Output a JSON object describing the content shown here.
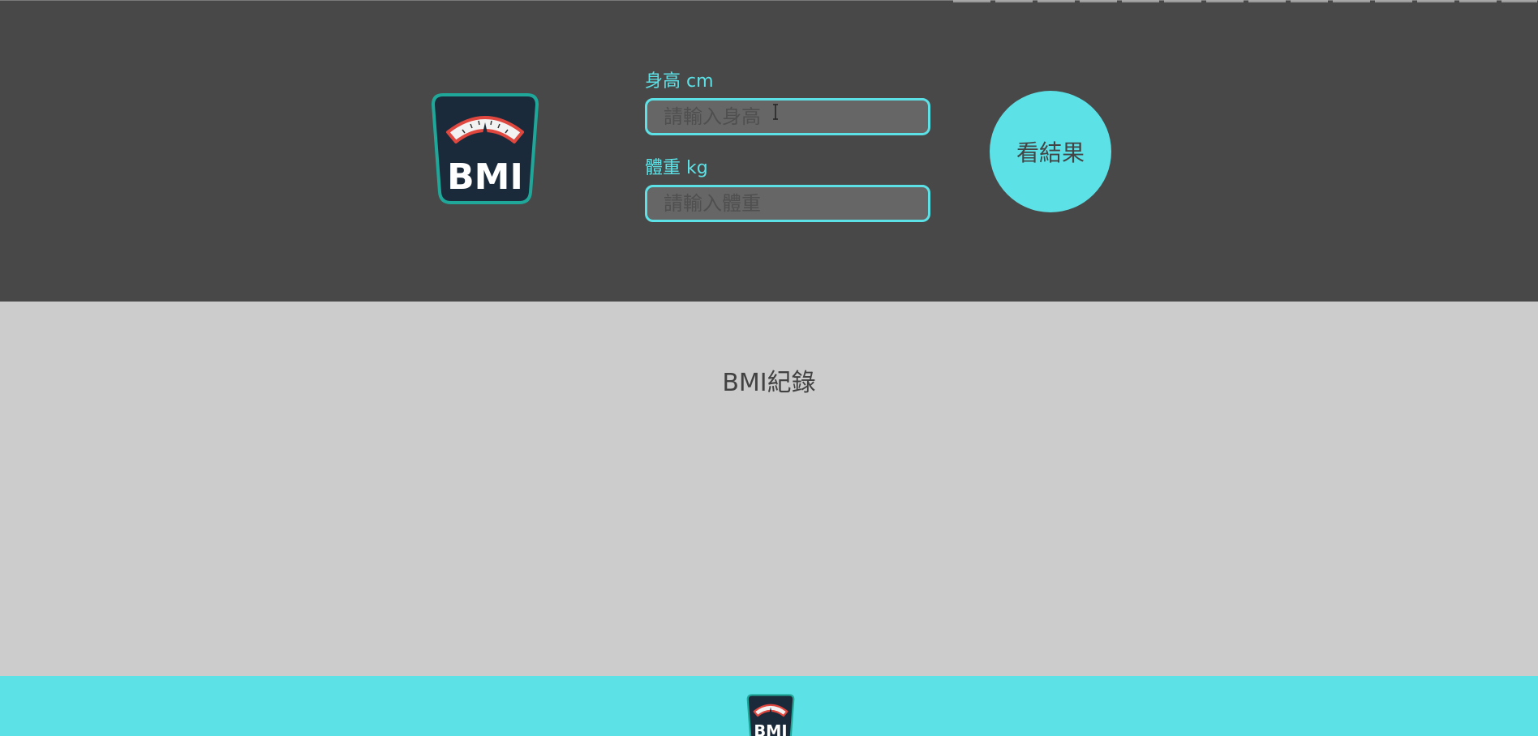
{
  "header": {
    "logo_icon": "bmi-scale-logo-icon",
    "logo_text": "BMI",
    "height_label": "身高 cm",
    "height_placeholder": "請輸入身高",
    "weight_label": "體重 kg",
    "weight_placeholder": "請輸入體重",
    "result_button_label": "看結果"
  },
  "records": {
    "title": "BMI紀錄"
  },
  "footer": {
    "logo_icon": "bmi-scale-logo-icon",
    "logo_text": "BMI"
  },
  "colors": {
    "accent": "#5ce1e6",
    "header_bg": "#484848",
    "content_bg": "#cccccc",
    "logo_bg": "#1b2a3a",
    "logo_border": "#1fa89a",
    "gauge_red": "#e0473f"
  }
}
